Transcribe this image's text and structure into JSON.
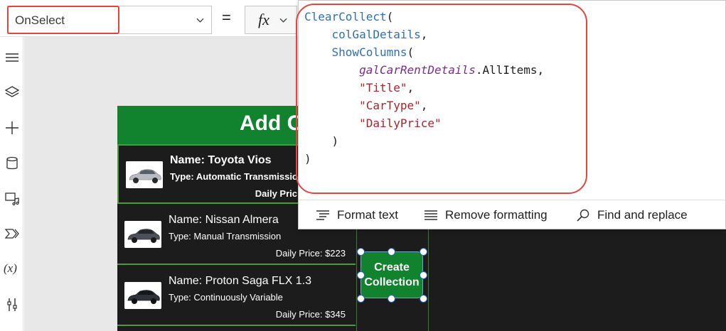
{
  "formula_bar": {
    "property": "OnSelect",
    "equals": "=",
    "fx_label": "fx"
  },
  "formula": {
    "l1_fn": "ClearCollect",
    "l1_p": "(",
    "l2": "colGalDetails",
    "l2_p": ",",
    "l3_fn": "ShowColumns",
    "l3_p": "(",
    "l4_ctl": "galCarRentDetails",
    "l4_rest": ".AllItems,",
    "l5": "\"Title\"",
    "l5_p": ",",
    "l6": "\"CarType\"",
    "l6_p": ",",
    "l7": "\"DailyPrice\"",
    "l8": ")",
    "l9": ")"
  },
  "editor_toolbar": {
    "format_text": "Format text",
    "remove_formatting": "Remove formatting",
    "find_replace": "Find and replace"
  },
  "screen": {
    "title": "Add C"
  },
  "gallery": {
    "items": [
      {
        "name": "Name: Toyota Vios",
        "type": "Type: Automatic Transmission",
        "price": "Daily Pric"
      },
      {
        "name": "Name: Nissan Almera",
        "type": "Type: Manual Transmission",
        "price": "Daily Price: $223"
      },
      {
        "name": "Name: Proton Saga FLX 1.3",
        "type": "Type: Continuously Variable",
        "price": "Daily Price: $345"
      }
    ]
  },
  "create_button": {
    "label": "Create\nCollection"
  },
  "left_rail": {
    "icons": [
      "hamburger-icon",
      "layers-icon",
      "plus-icon",
      "database-icon",
      "media-icon",
      "power-automate-icon",
      "variables-icon",
      "tools-icon"
    ],
    "variables_label": "(x)"
  },
  "colors": {
    "brand_green": "#11822e",
    "highlight_red": "#e0453f",
    "keyword_blue": "#2e6fb4",
    "control_purple": "#7d2a8e",
    "string_red": "#a4262c"
  }
}
